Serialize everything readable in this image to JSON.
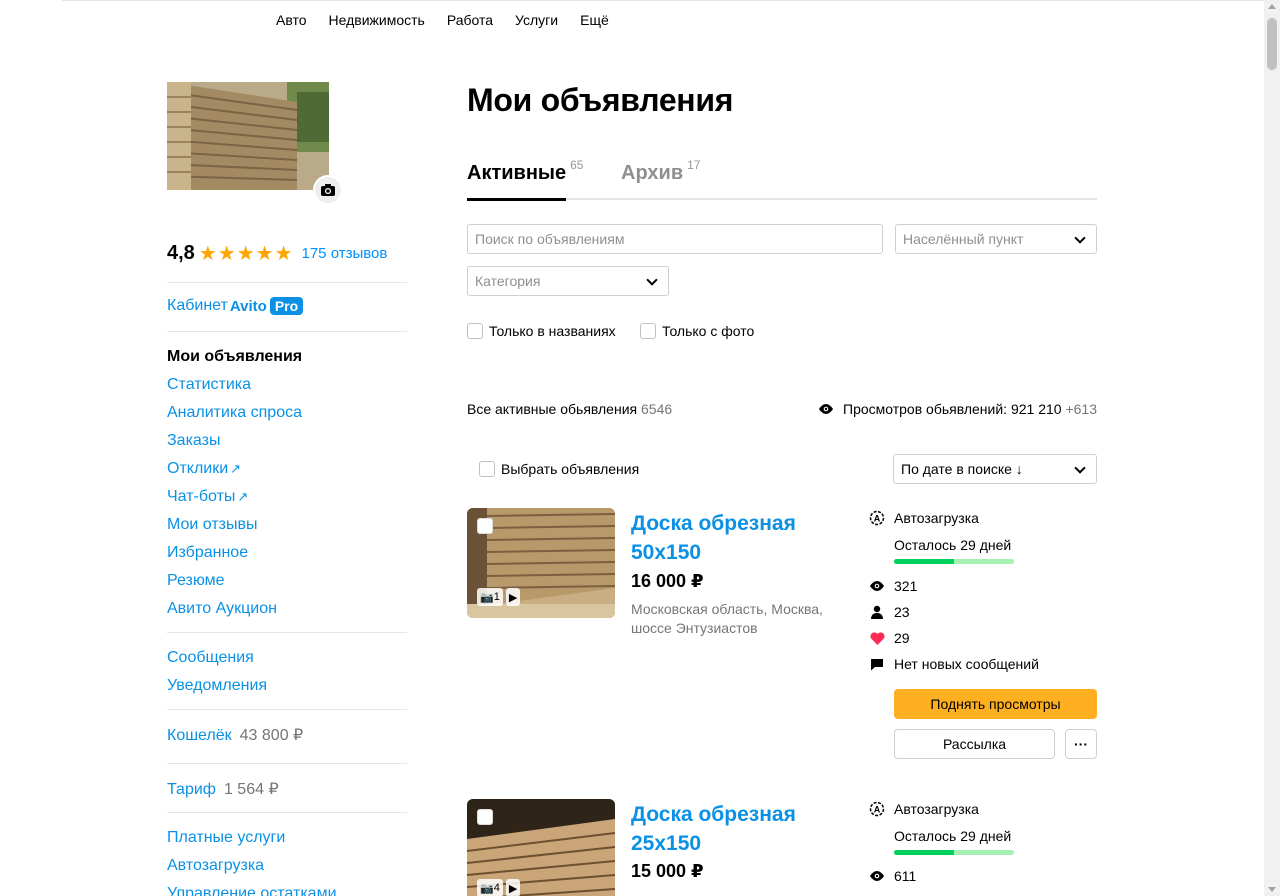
{
  "topnav": [
    "Авто",
    "Недвижимость",
    "Работа",
    "Услуги",
    "Ещё"
  ],
  "profile": {
    "rating": "4,8",
    "stars": 5,
    "reviews": "175 отзывов"
  },
  "sidebar": {
    "cabinet": "Кабинет",
    "cabinet_brand": "Avito",
    "cabinet_pro": "Pro",
    "menu": [
      "Мои объявления",
      "Статистика",
      "Аналитика спроса",
      "Заказы",
      "Отклики",
      "Чат-боты",
      "Мои отзывы",
      "Избранное",
      "Резюме",
      "Авито Аукцион"
    ],
    "messages": "Сообщения",
    "notifications": "Уведомления",
    "wallet_label": "Кошелёк",
    "wallet_value": "43 800 ₽",
    "tariff_label": "Тариф",
    "tariff_value": "1 564 ₽",
    "extra": [
      "Платные услуги",
      "Автозагрузка",
      "Управление остатками"
    ]
  },
  "main": {
    "title": "Мои объявления",
    "tabs": [
      {
        "label": "Активные",
        "count": "65"
      },
      {
        "label": "Архив",
        "count": "17"
      }
    ],
    "search_placeholder": "Поиск по объявлениям",
    "city_placeholder": "Населённый пункт",
    "category_placeholder": "Категория",
    "only_titles": "Только в названиях",
    "only_photo": "Только с фото",
    "all_active_label": "Все активные обьявления",
    "all_active_count": "6546",
    "views_label": "Просмотров обьявлений: 921 210",
    "views_plus": "+613",
    "select_label": "Выбрать объявления",
    "sort_label": "По дате в поиске ↓"
  },
  "listings": [
    {
      "title": "Доска обрезная 50х150",
      "price": "16 000 ₽",
      "address": "Московская область, Москва, шоссе Энтузиастов",
      "photo_count": "1",
      "autoload": "Автозагрузка",
      "remaining": "Осталось 29 дней",
      "remaining_fraction": 0.5,
      "views": "321",
      "contacts": "23",
      "favorites": "29",
      "messages": "Нет новых сообщений",
      "raise_button": "Поднять просмотры",
      "mailing_button": "Рассылка",
      "more_button": "···"
    },
    {
      "title": "Доска обрезная 25х150",
      "price": "15 000 ₽",
      "photo_count": "4",
      "autoload": "Автозагрузка",
      "remaining": "Осталось 29 дней",
      "remaining_fraction": 0.5,
      "views": "611"
    }
  ],
  "colors": {
    "link": "#0a91e6",
    "star": "#ffa500",
    "raise_button": "#ffb021",
    "progress": "#02d15c",
    "progress_track": "#a6f0b2",
    "heart": "#ff2d55"
  }
}
